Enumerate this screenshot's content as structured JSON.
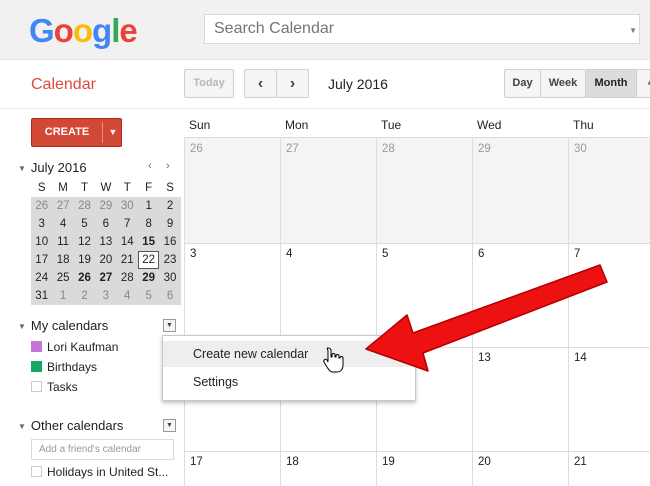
{
  "header": {
    "logo_letters": [
      {
        "ch": "G",
        "color": "#4285f4"
      },
      {
        "ch": "o",
        "color": "#ea4335"
      },
      {
        "ch": "o",
        "color": "#fbbc05"
      },
      {
        "ch": "g",
        "color": "#4285f4"
      },
      {
        "ch": "l",
        "color": "#34a853"
      },
      {
        "ch": "e",
        "color": "#ea4335"
      }
    ],
    "search_placeholder": "Search Calendar"
  },
  "toolbar": {
    "app_title": "Calendar",
    "today_label": "Today",
    "prev_label": "‹",
    "next_label": "›",
    "current_month": "July 2016",
    "view_day": "Day",
    "view_week": "Week",
    "view_month": "Month",
    "view_4days": "4"
  },
  "sidebar": {
    "create_label": "CREATE",
    "mini_calendar": {
      "title": "July 2016",
      "weekday_headers": [
        "S",
        "M",
        "T",
        "W",
        "T",
        "F",
        "S"
      ],
      "weeks": [
        [
          {
            "d": "26",
            "dim": true
          },
          {
            "d": "27",
            "dim": true
          },
          {
            "d": "28",
            "dim": true
          },
          {
            "d": "29",
            "dim": true
          },
          {
            "d": "30",
            "dim": true
          },
          {
            "d": "1"
          },
          {
            "d": "2"
          }
        ],
        [
          {
            "d": "3"
          },
          {
            "d": "4"
          },
          {
            "d": "5"
          },
          {
            "d": "6"
          },
          {
            "d": "7"
          },
          {
            "d": "8"
          },
          {
            "d": "9"
          }
        ],
        [
          {
            "d": "10"
          },
          {
            "d": "11"
          },
          {
            "d": "12"
          },
          {
            "d": "13"
          },
          {
            "d": "14"
          },
          {
            "d": "15",
            "bold": true
          },
          {
            "d": "16"
          }
        ],
        [
          {
            "d": "17"
          },
          {
            "d": "18"
          },
          {
            "d": "19"
          },
          {
            "d": "20"
          },
          {
            "d": "21"
          },
          {
            "d": "22",
            "today": true
          },
          {
            "d": "23"
          }
        ],
        [
          {
            "d": "24"
          },
          {
            "d": "25"
          },
          {
            "d": "26",
            "bold": true
          },
          {
            "d": "27",
            "bold": true
          },
          {
            "d": "28"
          },
          {
            "d": "29",
            "bold": true
          },
          {
            "d": "30"
          }
        ],
        [
          {
            "d": "31"
          },
          {
            "d": "1",
            "dim": true
          },
          {
            "d": "2",
            "dim": true
          },
          {
            "d": "3",
            "dim": true
          },
          {
            "d": "4",
            "dim": true
          },
          {
            "d": "5",
            "dim": true
          },
          {
            "d": "6",
            "dim": true
          }
        ]
      ]
    },
    "my_calendars": {
      "heading": "My calendars",
      "items": [
        {
          "label": "Lori Kaufman",
          "color": "#c774d8"
        },
        {
          "label": "Birthdays",
          "color": "#16a765"
        },
        {
          "label": "Tasks",
          "color": "#ffffff"
        }
      ]
    },
    "other_calendars": {
      "heading": "Other calendars",
      "friend_placeholder": "Add a friend's calendar",
      "items": [
        {
          "label": "Holidays in United St...",
          "color": "#ffffff"
        }
      ]
    }
  },
  "grid": {
    "weekday_headers": [
      "Sun",
      "Mon",
      "Tue",
      "Wed",
      "Thu"
    ],
    "weeks": [
      [
        {
          "d": "26",
          "dim": true
        },
        {
          "d": "27",
          "dim": true
        },
        {
          "d": "28",
          "dim": true
        },
        {
          "d": "29",
          "dim": true
        },
        {
          "d": "30",
          "dim": true
        }
      ],
      [
        {
          "d": "3"
        },
        {
          "d": "4"
        },
        {
          "d": "5"
        },
        {
          "d": "6"
        },
        {
          "d": "7"
        }
      ],
      [
        {
          "d": ""
        },
        {
          "d": ""
        },
        {
          "d": ""
        },
        {
          "d": "13"
        },
        {
          "d": "14"
        }
      ],
      [
        {
          "d": "17"
        },
        {
          "d": "18"
        },
        {
          "d": "19"
        },
        {
          "d": "20"
        },
        {
          "d": "21"
        }
      ]
    ]
  },
  "popup": {
    "items": [
      "Create new calendar",
      "Settings"
    ]
  },
  "annotation": {
    "arrow_color": "#ee1111"
  }
}
